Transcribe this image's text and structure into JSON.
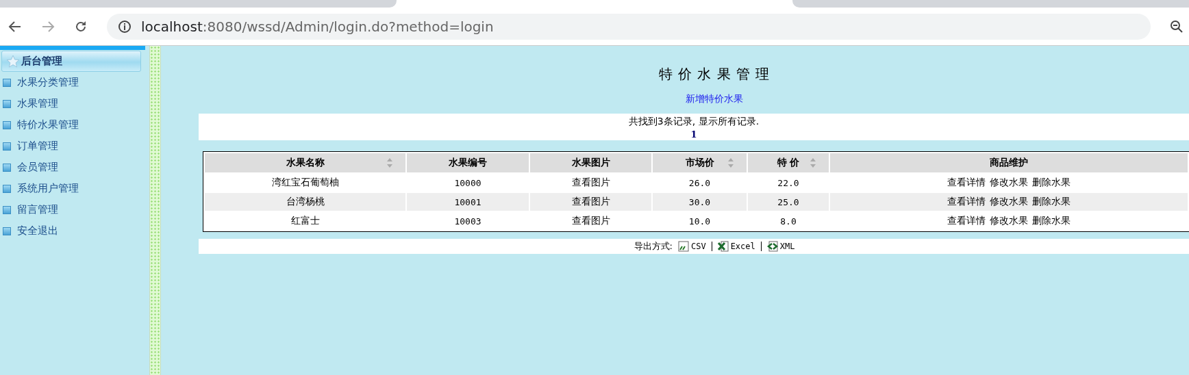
{
  "browser": {
    "url_host": "localhost",
    "url_path": ":8080/wssd/Admin/login.do?method=login"
  },
  "sidebar": {
    "title": "后台管理",
    "items": [
      "水果分类管理",
      "水果管理",
      "特价水果管理",
      "订单管理",
      "会员管理",
      "系统用户管理",
      "留言管理",
      "安全退出"
    ]
  },
  "page_title": "特 价 水 果 管 理",
  "add_link": "新增特价水果",
  "summary": "共找到3条记录, 显示所有记录.",
  "pages": [
    "1"
  ],
  "table": {
    "columns": [
      {
        "label": "水果名称",
        "sortable": true
      },
      {
        "label": "水果编号",
        "sortable": false
      },
      {
        "label": "水果图片",
        "sortable": false
      },
      {
        "label": "市场价",
        "sortable": true
      },
      {
        "label": "特 价",
        "sortable": true
      },
      {
        "label": "商品维护",
        "sortable": false
      }
    ],
    "rows": [
      {
        "name": "湾红宝石葡萄柚",
        "id": "10000",
        "picture": "查看图片",
        "market": "26.0",
        "special": "22.0",
        "actions": [
          "查看详情",
          "修改水果",
          "删除水果"
        ]
      },
      {
        "name": "台湾杨桃",
        "id": "10001",
        "picture": "查看图片",
        "market": "30.0",
        "special": "25.0",
        "actions": [
          "查看详情",
          "修改水果",
          "删除水果"
        ]
      },
      {
        "name": "红富士",
        "id": "10003",
        "picture": "查看图片",
        "market": "10.0",
        "special": "8.0",
        "actions": [
          "查看详情",
          "修改水果",
          "删除水果"
        ]
      }
    ]
  },
  "export": {
    "label": "导出方式:",
    "options": [
      {
        "kind": "csv",
        "label": "CSV"
      },
      {
        "kind": "excel",
        "label": "Excel"
      },
      {
        "kind": "xml",
        "label": "XML"
      }
    ]
  }
}
